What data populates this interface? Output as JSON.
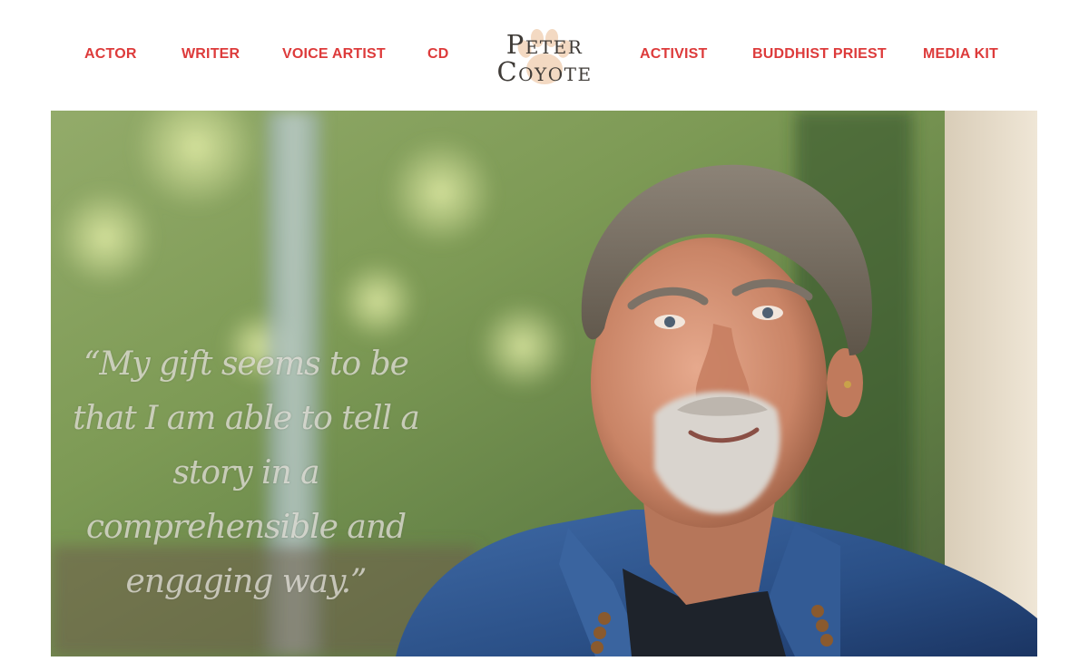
{
  "nav": {
    "left_items": [
      {
        "label": "ACTOR"
      },
      {
        "label": "WRITER"
      },
      {
        "label": "VOICE ARTIST"
      },
      {
        "label": "CD"
      }
    ],
    "right_items": [
      {
        "label": "ACTIVIST"
      },
      {
        "label": "BUDDHIST PRIEST"
      },
      {
        "label": "MEDIA KIT"
      }
    ]
  },
  "logo": {
    "line1": "Peter",
    "line2": "Coyote",
    "emblem": "paw-print-icon"
  },
  "hero": {
    "image": "portrait of a smiling grey-haired man in a denim shirt",
    "quote": "“My gift seems to be that I am able to tell a story in a comprehensible and engaging way.”"
  },
  "colors": {
    "nav_text": "#dd3b3b",
    "logo_text": "#3f3b37",
    "paw": "#f3d9c2",
    "quote_text": "#ebe8e2"
  }
}
